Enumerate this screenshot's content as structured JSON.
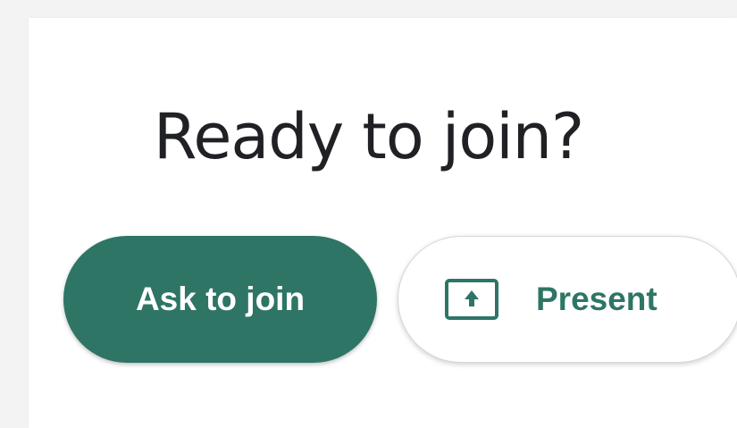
{
  "join_panel": {
    "title": "Ready to join?",
    "ask_button_label": "Ask to join",
    "present_button_label": "Present",
    "present_icon": "present-screen-icon"
  },
  "colors": {
    "accent": "#2e7566",
    "title_text": "#202124",
    "background": "#f3f3f3",
    "panel": "#ffffff"
  }
}
